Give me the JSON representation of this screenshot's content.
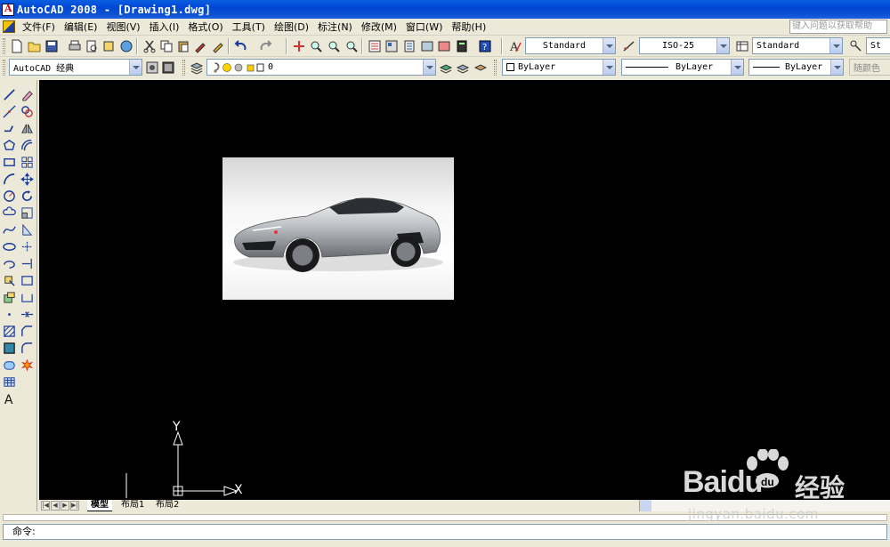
{
  "window": {
    "title": "AutoCAD 2008 - [Drawing1.dwg]"
  },
  "menu": {
    "items": [
      "文件(F)",
      "编辑(E)",
      "视图(V)",
      "插入(I)",
      "格式(O)",
      "工具(T)",
      "绘图(D)",
      "标注(N)",
      "修改(M)",
      "窗口(W)",
      "帮助(H)"
    ],
    "help_placeholder": "键入问题以获取帮助"
  },
  "styles_toolbar": {
    "text_style": "Standard",
    "dim_style": "ISO-25",
    "table_style": "Standard",
    "multileader_style": "St"
  },
  "workspace": {
    "name": "AutoCAD 经典"
  },
  "layers": {
    "current_layer": "0"
  },
  "properties": {
    "color": "ByLayer",
    "linetype": "ByLayer",
    "lineweight": "ByLayer",
    "plot_style": "随颜色"
  },
  "ucs": {
    "x_label": "X",
    "y_label": "Y"
  },
  "layout_tabs": [
    "模型",
    "布局1",
    "布局2"
  ],
  "command_line": {
    "prompt": "命令:"
  },
  "watermark": {
    "brand": "Baidu",
    "brand_cn": "经验",
    "url": "jingyan.baidu.com"
  },
  "colors": {
    "titlebar": "#0046d5",
    "canvas": "#000000",
    "chrome": "#ece9d8"
  }
}
